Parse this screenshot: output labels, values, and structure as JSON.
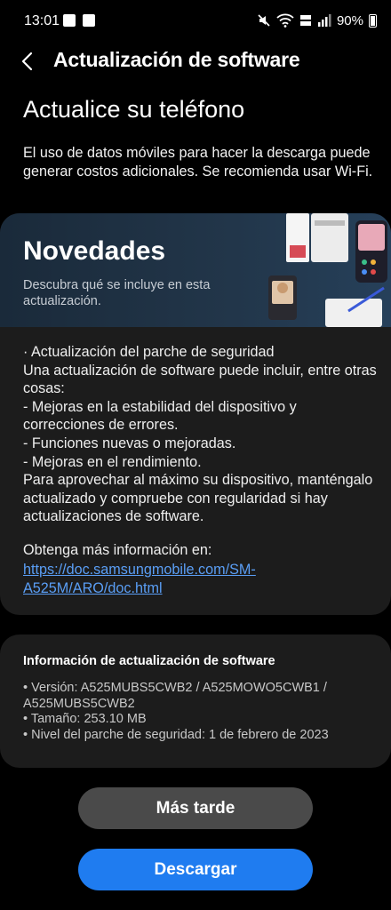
{
  "status_bar": {
    "time": "13:01",
    "battery": "90%",
    "icons": [
      "photo-icon",
      "gallery-icon",
      "mute-icon",
      "wifi-icon",
      "volte-lte-icon",
      "signal-icon",
      "battery-icon"
    ]
  },
  "header": {
    "back_icon": "chevron-left-icon",
    "title": "Actualización de software"
  },
  "main": {
    "heading": "Actualice su teléfono",
    "warning": "El uso de datos móviles para hacer la descarga puede generar costos adicionales. Se recomienda usar Wi-Fi."
  },
  "whats_new": {
    "title": "Novedades",
    "subtitle": "Descubra qué se incluye en esta actualización.",
    "body": "· Actualización del parche de seguridad\nUna actualización de software puede incluir, entre otras cosas:\n - Mejoras en la estabilidad del dispositivo y correcciones de errores.\n - Funciones nuevas o mejoradas.\n - Mejoras en el rendimiento.\nPara aprovechar al máximo su dispositivo, manténgalo actualizado y compruebe con regularidad si hay actualizaciones de software.",
    "more_info": "Obtenga más información en:",
    "link": "https://doc.samsungmobile.com/SM-A525M/ARO/doc.html"
  },
  "update_info": {
    "title": "Información de actualización de software",
    "version": "• Versión: A525MUBS5CWB2 / A525MOWO5CWB1 /\n  A525MUBS5CWB2",
    "size": "• Tamaño: 253.10 MB",
    "patch": "• Nivel del parche de seguridad: 1 de febrero de 2023"
  },
  "buttons": {
    "later": "Más tarde",
    "download": "Descargar"
  },
  "colors": {
    "background": "#000000",
    "card": "#1c1c1c",
    "link": "#5a9ef5",
    "primary_button": "#1f7cf0",
    "secondary_button": "#4a4a4a"
  }
}
